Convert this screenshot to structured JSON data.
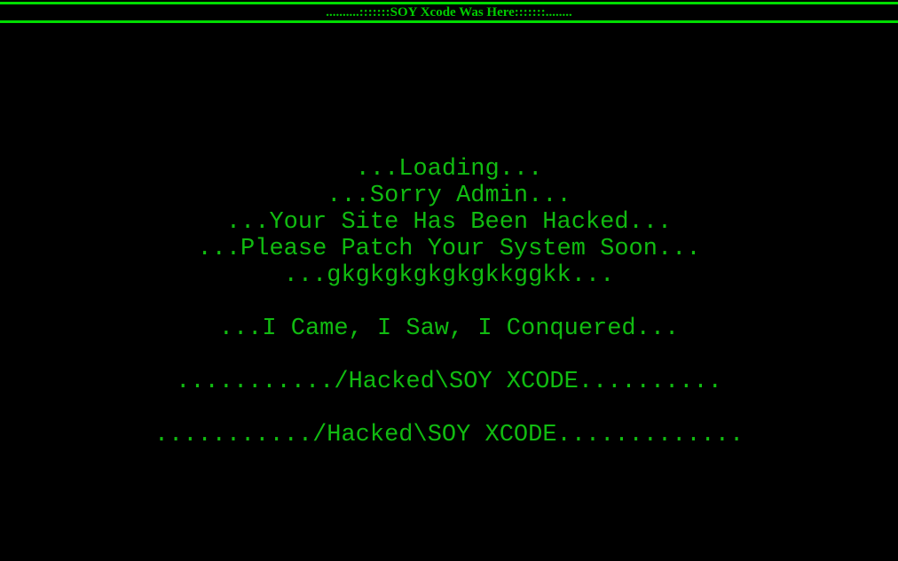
{
  "page": {
    "background_color": "#000000",
    "text_color": "#11bb11",
    "accent_color": "#00dd00"
  },
  "banner": {
    "text": "..........:::::::SOY Xcode Was Here:::::::........",
    "color": "#00cc00"
  },
  "console": {
    "lines": [
      {
        "id": "loading",
        "text": "...Loading..."
      },
      {
        "id": "sorry",
        "text": "...Sorry Admin..."
      },
      {
        "id": "hacked",
        "text": "...Your Site Has Been Hacked..."
      },
      {
        "id": "patch",
        "text": "...Please Patch Your System Soon..."
      },
      {
        "id": "gibberish",
        "text": "...gkgkgkgkgkgkkggkk..."
      },
      {
        "id": "blank1",
        "text": " "
      },
      {
        "id": "veni",
        "text": "...I Came, I Saw, I Conquered..."
      },
      {
        "id": "blank2",
        "text": " "
      },
      {
        "id": "sig1",
        "text": ".........../Hacked\\SOY XCODE.........."
      },
      {
        "id": "blank3",
        "text": " "
      },
      {
        "id": "sig2",
        "text": ".........../Hacked\\SOY XCODE............."
      }
    ]
  }
}
